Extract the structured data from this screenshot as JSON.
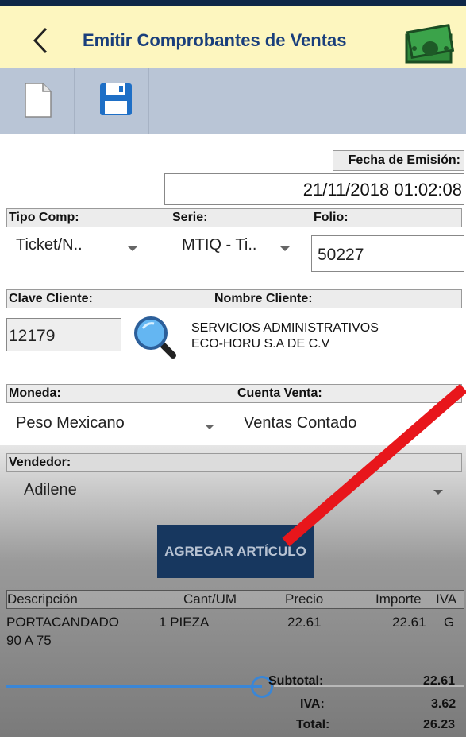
{
  "header": {
    "back_icon": "chevron-left-icon",
    "title": "Emitir Comprobantes de Ventas",
    "money_icon": "money-bill-icon"
  },
  "toolbar": {
    "new_icon": "new-document-icon",
    "save_icon": "save-disk-icon"
  },
  "form": {
    "fecha_label": "Fecha de Emisión:",
    "fecha_value": "21/11/2018 01:02:08",
    "tipo_comp_label": "Tipo Comp:",
    "serie_label": "Serie:",
    "folio_label": "Folio:",
    "tipo_comp_value": "Ticket/N..",
    "serie_value": "MTIQ - Ti..",
    "folio_value": "50227",
    "clave_cliente_label": "Clave Cliente:",
    "nombre_cliente_label": "Nombre Cliente:",
    "clave_cliente_value": "12179",
    "nombre_cliente_line1": "SERVICIOS ADMINISTRATIVOS",
    "nombre_cliente_line2": "ECO-HORU S.A DE C.V",
    "moneda_label": "Moneda:",
    "cuenta_venta_label": "Cuenta Venta:",
    "moneda_value": "Peso Mexicano",
    "cuenta_venta_value": "Ventas Contado",
    "vendedor_label": "Vendedor:",
    "vendedor_value": "Adilene"
  },
  "actions": {
    "agregar_label": "AGREGAR ARTÍCULO"
  },
  "items_table": {
    "headers": [
      "Descripción",
      "Cant/UM",
      "Precio",
      "Importe",
      "IVA"
    ],
    "rows": [
      {
        "descripcion_line1": "PORTACANDADO",
        "descripcion_line2": "90 A 75",
        "cant_um": "1 PIEZA",
        "precio": "22.61",
        "importe": "22.61",
        "iva": "G"
      }
    ]
  },
  "totals": {
    "subtotal_label": "Subtotal:",
    "subtotal_value": "22.61",
    "iva_label": "IVA:",
    "iva_value": "3.62",
    "total_label": "Total:",
    "total_value": "26.23"
  },
  "colors": {
    "header_bg": "#fdf6bf",
    "title_color": "#1a3f7c",
    "toolbar_bg": "#b9c5d6",
    "button_bg": "#17375f",
    "annotation_arrow": "#e8161b",
    "slider": "#3a86d6"
  }
}
